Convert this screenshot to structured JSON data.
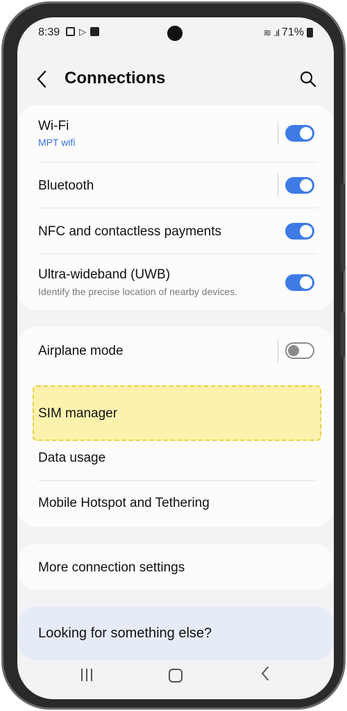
{
  "status_bar": {
    "time": "8:39",
    "battery": "71%"
  },
  "header": {
    "title": "Connections"
  },
  "group1": {
    "wifi": {
      "label": "Wi-Fi",
      "sub": "MPT wifi",
      "on": true
    },
    "bluetooth": {
      "label": "Bluetooth",
      "on": true
    },
    "nfc": {
      "label": "NFC and contactless payments",
      "on": true
    },
    "uwb": {
      "label": "Ultra-wideband (UWB)",
      "sub": "Identify the precise location of nearby devices.",
      "on": true
    }
  },
  "group2": {
    "airplane": {
      "label": "Airplane mode",
      "on": false
    },
    "sim_manager": {
      "label": "SIM manager"
    },
    "data_usage": {
      "label": "Data usage"
    },
    "hotspot": {
      "label": "Mobile Hotspot and Tethering"
    }
  },
  "group3": {
    "more": {
      "label": "More connection settings"
    }
  },
  "looking": {
    "label": "Looking for something else?"
  },
  "colors": {
    "accent": "#3e7be6",
    "highlight": "#fcf0a0",
    "sub_blue": "#3a71e0"
  }
}
